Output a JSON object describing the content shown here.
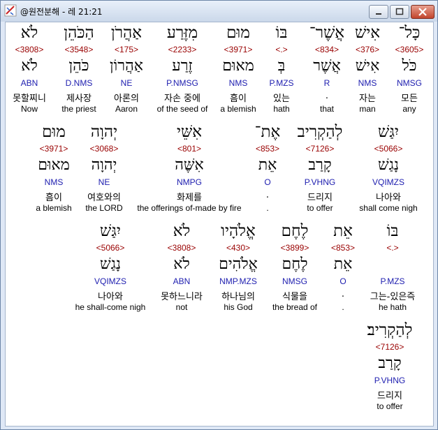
{
  "window": {
    "title": "@원전분해 - 레 21:21"
  },
  "rows": [
    {
      "words": [
        {
          "heb": "כָּל־",
          "num": "<3605>",
          "root": "כֹּל",
          "morph": "NMSG",
          "kor": "모든",
          "eng": "any"
        },
        {
          "heb": "אִישׁ",
          "num": "<376>",
          "root": "אִישׁ",
          "morph": "NMS",
          "kor": "자는",
          "eng": "man"
        },
        {
          "heb": "אֲשֶׁר־",
          "num": "<834>",
          "root": "אֲשֶׁר",
          "morph": "R",
          "kor": ".",
          "eng": "that"
        },
        {
          "heb": "בּוֹ",
          "num": "<.>",
          "root": "בְּ",
          "morph": "P.MZS",
          "kor": "있는",
          "eng": "hath"
        },
        {
          "heb": "מוּם",
          "num": "<3971>",
          "root": "מאוּם",
          "morph": "NMS",
          "kor": "흠이",
          "eng": "a blemish"
        },
        {
          "heb": "מִזֶּרַע",
          "num": "<2233>",
          "root": "זֶרַע",
          "morph": "P.NMSG",
          "kor": "자손 중에",
          "eng": "of the seed of"
        },
        {
          "heb": "אַהֲרֹן",
          "num": "<175>",
          "root": "אַהֲרוֹן",
          "morph": "NE",
          "kor": "아론의",
          "eng": "Aaron"
        },
        {
          "heb": "הַכֹּהֵן",
          "num": "<3548>",
          "root": "כֹּהֵן",
          "morph": "D.NMS",
          "kor": "제사장",
          "eng": "the priest"
        },
        {
          "heb": "לֹא",
          "num": "<3808>",
          "root": "לֹא",
          "morph": "ABN",
          "kor": "못할찌니",
          "eng": "Now"
        }
      ]
    },
    {
      "words": [
        {
          "heb": "יִגַּשׁ",
          "num": "<5066>",
          "root": "נָגַשׁ",
          "morph": "VQIMZS",
          "kor": "나아와",
          "eng": "shall come nigh"
        },
        {
          "heb": "לְהַקְרִיב",
          "num": "<7126>",
          "root": "קָרַב",
          "morph": "P.VHNG",
          "kor": "드리지",
          "eng": "to offer"
        },
        {
          "heb": "אֶת־",
          "num": "<853>",
          "root": "אֵת",
          "morph": "O",
          "kor": ".",
          "eng": "."
        },
        {
          "heb": "אִשֵּׁי",
          "num": "<801>",
          "root": "אִשֶּׁה",
          "morph": "NMPG",
          "kor": "화제를",
          "eng": "the offerings of-made by fire"
        },
        {
          "heb": "יְהוָה",
          "num": "<3068>",
          "root": "יְהוָה",
          "morph": "NE",
          "kor": "여호와의",
          "eng": "the LORD"
        },
        {
          "heb": "מוּם",
          "num": "<3971>",
          "root": "מאוּם",
          "morph": "NMS",
          "kor": "흠이",
          "eng": "a blemish"
        }
      ]
    },
    {
      "words": [
        {
          "heb": "בּוֹ",
          "num": "<.>",
          "root": "",
          "morph": "P.MZS",
          "kor": "그는-있은즉",
          "eng": "he hath"
        },
        {
          "heb": "אֵת",
          "num": "<853>",
          "root": "אֵת",
          "morph": "O",
          "kor": ".",
          "eng": "."
        },
        {
          "heb": "לֶחֶם",
          "num": "<3899>",
          "root": "לֶחֶם",
          "morph": "NMSG",
          "kor": "식물을",
          "eng": "the bread of"
        },
        {
          "heb": "אֱלֹהָיו",
          "num": "<430>",
          "root": "אֱלֹהִים",
          "morph": "NMP.MZS",
          "kor": "하나님의",
          "eng": "his God"
        },
        {
          "heb": "לֹא",
          "num": "<3808>",
          "root": "לֹא",
          "morph": "ABN",
          "kor": "못하느니라",
          "eng": "not"
        },
        {
          "heb": "יִגַּשׁ",
          "num": "<5066>",
          "root": "נָגַשׁ",
          "morph": "VQIMZS",
          "kor": "나아와",
          "eng": "he shall-come nigh"
        }
      ]
    },
    {
      "words": [
        {
          "heb": "לְהַקְרִיב׃",
          "num": "<7126>",
          "root": "קָרַב",
          "morph": "P.VHNG",
          "kor": "드리지",
          "eng": "to offer"
        }
      ]
    }
  ]
}
